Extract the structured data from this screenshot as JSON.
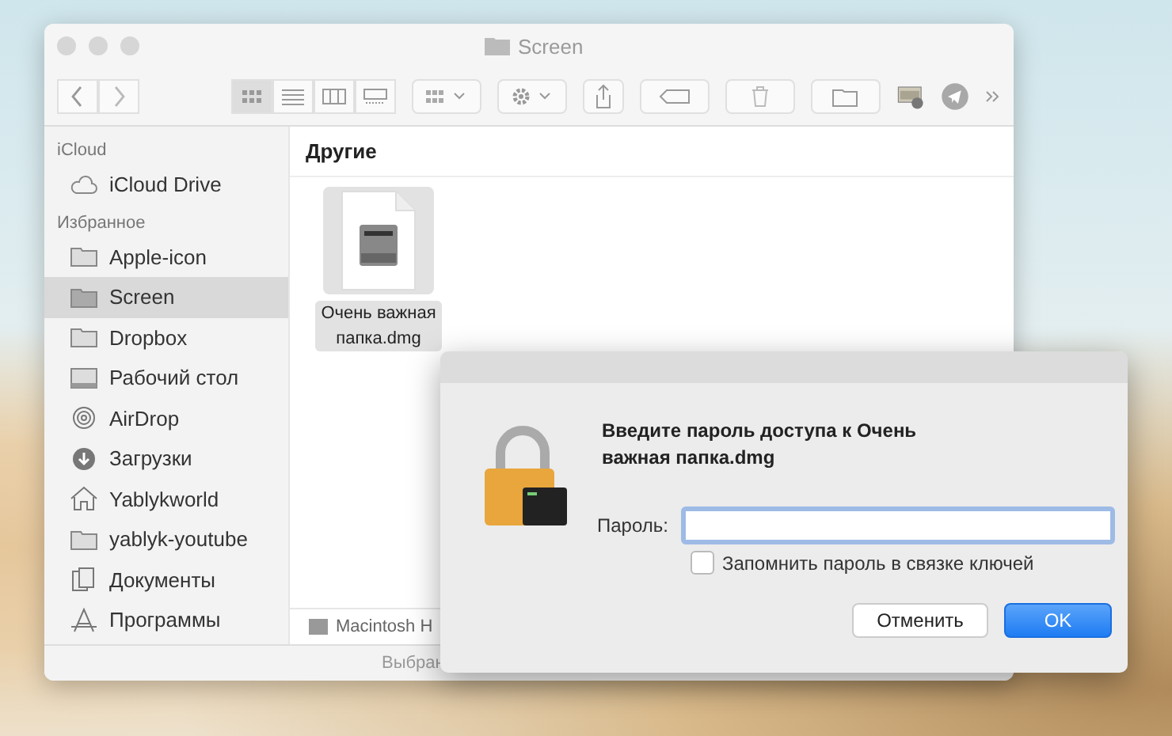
{
  "finder": {
    "title": "Screen",
    "view_modes": [
      {
        "kind": "icons",
        "selected": true
      },
      {
        "kind": "list",
        "selected": false
      },
      {
        "kind": "columns",
        "selected": false
      },
      {
        "kind": "gallery",
        "selected": false
      }
    ],
    "sidebar": [
      {
        "heading": "iCloud",
        "items": [
          {
            "label": "iCloud Drive",
            "kind": "cloud",
            "selected": false
          }
        ]
      },
      {
        "heading": "Избранное",
        "items": [
          {
            "label": "Apple-icon",
            "kind": "folder",
            "selected": false
          },
          {
            "label": "Screen",
            "kind": "folder",
            "selected": true
          },
          {
            "label": "Dropbox",
            "kind": "folder",
            "selected": false
          },
          {
            "label": "Рабочий стол",
            "kind": "desktop",
            "selected": false
          },
          {
            "label": "AirDrop",
            "kind": "airdrop",
            "selected": false
          },
          {
            "label": "Загрузки",
            "kind": "download",
            "selected": false
          },
          {
            "label": "Yablykworld",
            "kind": "home",
            "selected": false
          },
          {
            "label": "yablyk-youtube",
            "kind": "folder",
            "selected": false
          },
          {
            "label": "Документы",
            "kind": "documents",
            "selected": false
          },
          {
            "label": "Программы",
            "kind": "apps",
            "selected": false
          }
        ]
      }
    ],
    "section_title": "Другие",
    "files": [
      {
        "name": "Очень важная папка.dmg",
        "selected": true
      }
    ],
    "path_bar": "Macintosh H",
    "status_bar": "Выбран"
  },
  "dialog": {
    "message": "Введите пароль доступа к Очень важная папка.dmg",
    "password_label": "Пароль:",
    "remember": {
      "label": "Запомнить пароль в связке ключей",
      "checked": false
    },
    "buttons": [
      {
        "label": "Отменить",
        "kind": "secondary"
      },
      {
        "label": "OK",
        "kind": "primary"
      }
    ]
  }
}
